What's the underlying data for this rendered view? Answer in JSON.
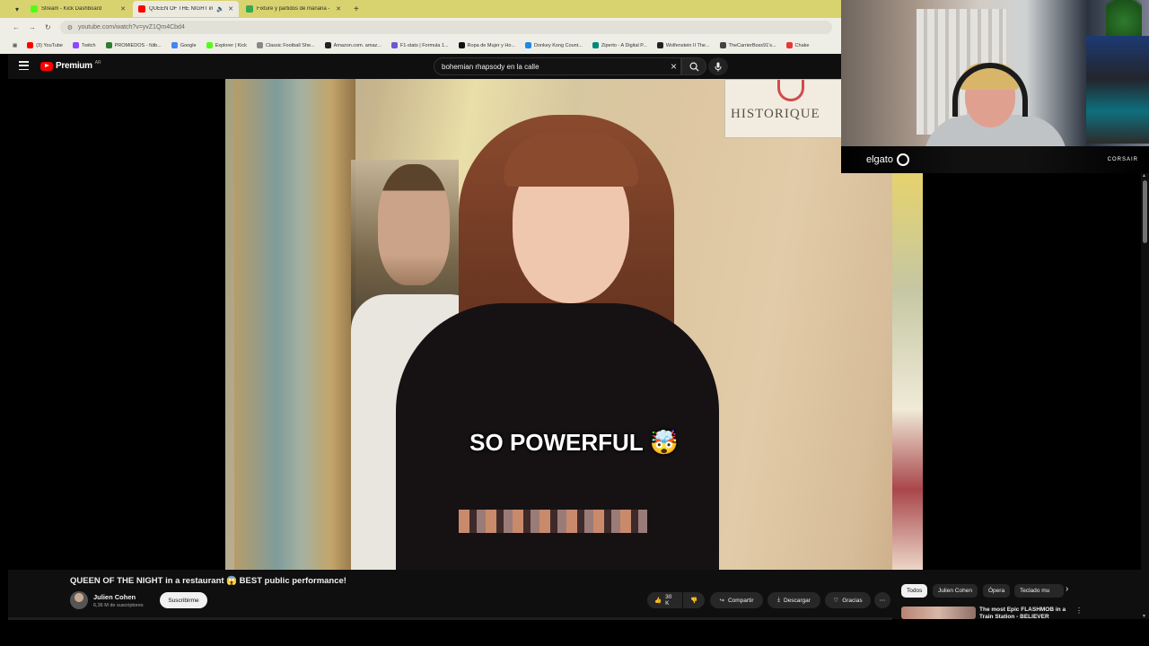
{
  "browser": {
    "tabs": [
      {
        "title": "Stream - Kick Dashboard",
        "color": "#53fc18",
        "active": false
      },
      {
        "title": "QUEEN OF THE NIGHT in a r",
        "color": "#ff0000",
        "active": true
      },
      {
        "title": "Fixture y partidos de mañana -",
        "color": "#34a853",
        "active": false
      }
    ],
    "new_tab": "+",
    "url": "youtube.com/watch?v=yvZ1Qm4Cbd4",
    "bookmarks": [
      {
        "label": "(3) YouTube",
        "color": "#ff0000"
      },
      {
        "label": "Twitch",
        "color": "#9146ff"
      },
      {
        "label": "PROMIEDOS - fútb...",
        "color": "#2e7d32"
      },
      {
        "label": "Google",
        "color": "#4285f4"
      },
      {
        "label": "Explorer | Kick",
        "color": "#53fc18"
      },
      {
        "label": "Classic Football She...",
        "color": "#888888"
      },
      {
        "label": "Amazon.com. amaz...",
        "color": "#222222"
      },
      {
        "label": "F1-stats | Formula 1...",
        "color": "#6a5acd"
      },
      {
        "label": "Ropa de Mujer y Ho...",
        "color": "#111111"
      },
      {
        "label": "Donkey Kong Count...",
        "color": "#1e88e5"
      },
      {
        "label": "Ziperto - A Digital P...",
        "color": "#00897b"
      },
      {
        "label": "Wolfenstein II The...",
        "color": "#222222"
      },
      {
        "label": "TheCarrierBoss91's...",
        "color": "#444444"
      },
      {
        "label": "Chake",
        "color": "#e53935"
      }
    ]
  },
  "youtube": {
    "logo_text": "Premium",
    "logo_region": "AR",
    "search_value": "bohemian rhapsody en la calle",
    "video_caption": "SO POWERFUL 🤯",
    "sign_text": "HISTORIQUE",
    "video_title": "QUEEN OF THE NIGHT in a restaurant 😱 BEST public performance!",
    "channel_name": "Julien Cohen",
    "subscribers": "6,36 M de suscriptores",
    "subscribe_label": "Suscribirme",
    "likes": "30 K",
    "share_label": "Compartir",
    "download_label": "Descargar",
    "thanks_label": "Gracias",
    "more_label": "⋯",
    "chips": [
      "Todos",
      "Julien Cohen",
      "Ópera",
      "Teclado mu"
    ],
    "recommended_title": "The most Epic FLASHMOB in a Train Station - BELIEVER"
  },
  "webcam": {
    "brand_left": "elgato",
    "brand_right": "CORSAIR"
  }
}
